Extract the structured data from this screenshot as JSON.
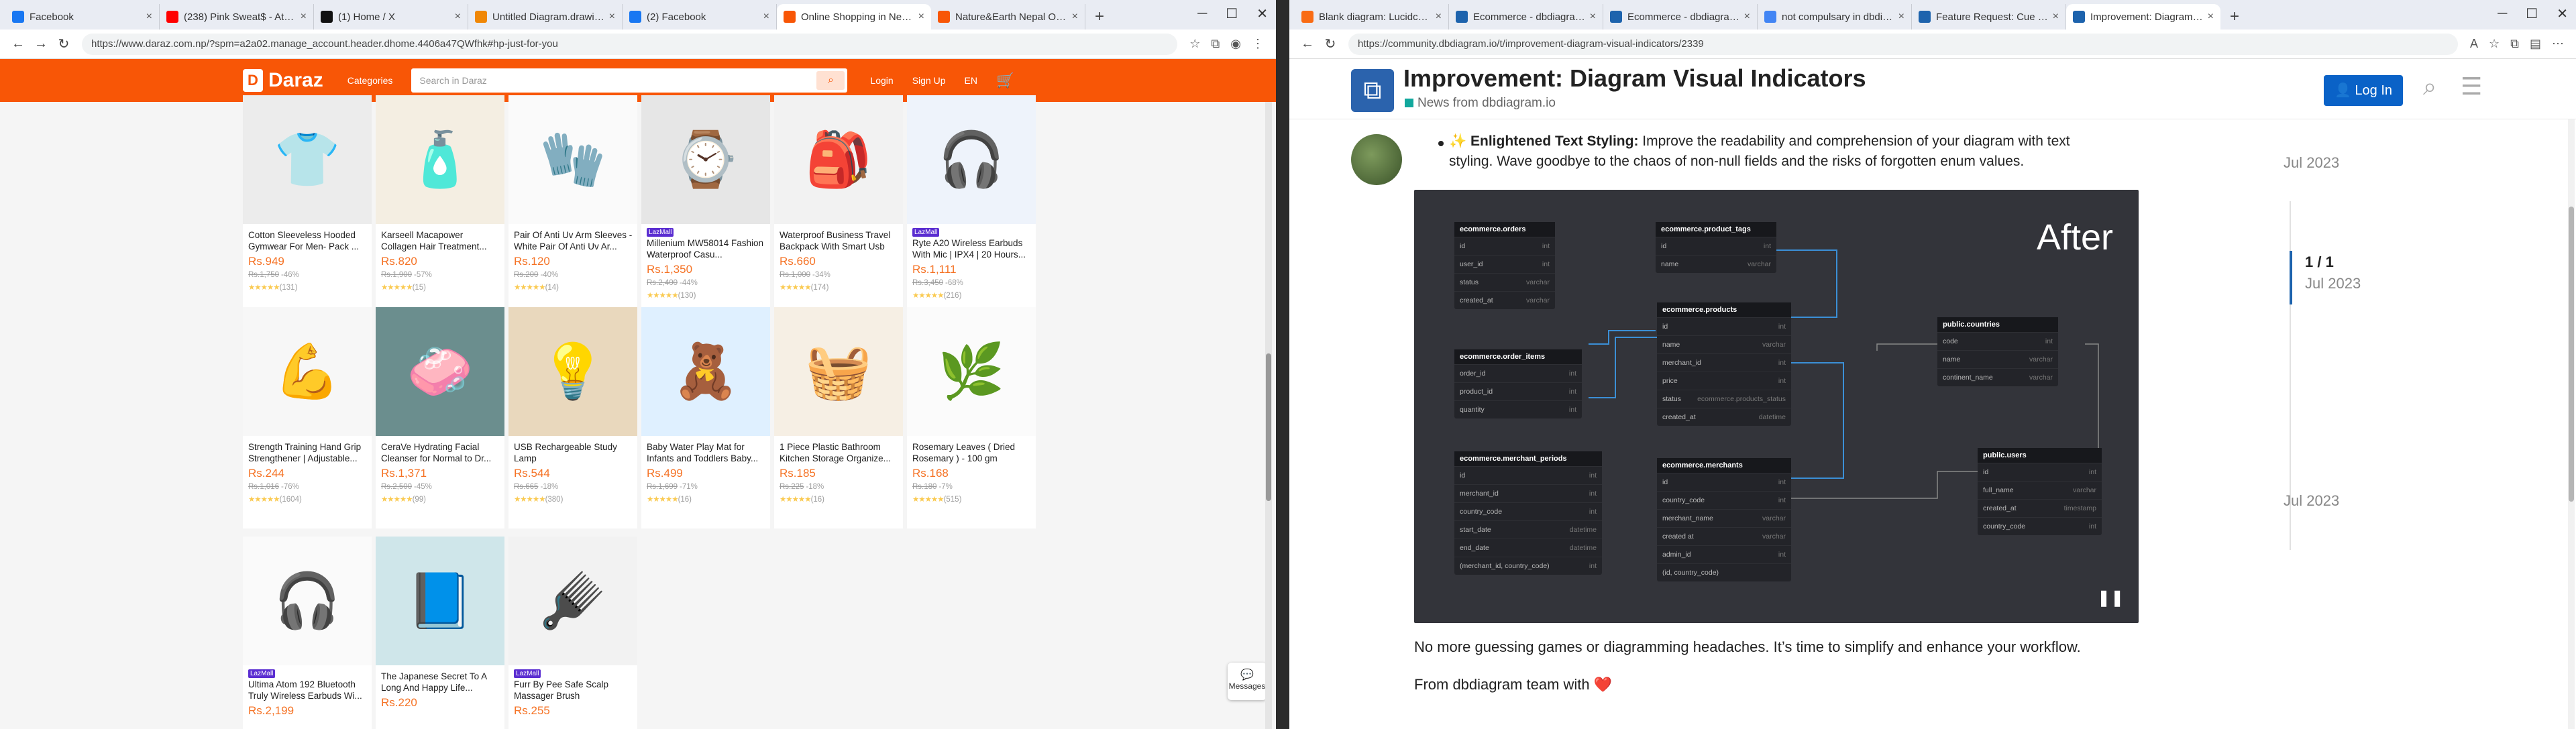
{
  "left": {
    "tabs": [
      {
        "label": "Facebook",
        "icon": "facebook-icon",
        "color": "#1877f2"
      },
      {
        "label": "(238) Pink Sweat$ - At My W...",
        "icon": "youtube-icon",
        "color": "#ff0000"
      },
      {
        "label": "(1) Home / X",
        "icon": "x-icon",
        "color": "#111111"
      },
      {
        "label": "Untitled Diagram.drawio - draw...",
        "icon": "drawio-icon",
        "color": "#f08705"
      },
      {
        "label": "(2) Facebook",
        "icon": "facebook-icon",
        "color": "#1877f2"
      },
      {
        "label": "Online Shopping in Nepal | Best...",
        "icon": "daraz-icon",
        "color": "#f85606"
      },
      {
        "label": "Nature&Earth Nepal Official Onl...",
        "icon": "daraz-icon",
        "color": "#f85606"
      }
    ],
    "url": "https://www.daraz.com.np/?spm=a2a02.manage_account.header.dhome.4406a47QWfhk#hp-just-for-you",
    "header": {
      "logo": "Daraz",
      "categories": "Categories",
      "search_placeholder": "Search in Daraz",
      "login": "Login",
      "signup": "Sign Up",
      "lang": "EN"
    },
    "products": [
      {
        "name": "Cotton Sleeveless Hooded Gymwear For Men- Pack ...",
        "price": "Rs.949",
        "old": "Rs.1,750",
        "disc": "-46%",
        "stars": "★★★★★",
        "reviews": "(131)",
        "emoji": "👕",
        "bg": "#ececec",
        "lzd": ""
      },
      {
        "name": "Karseell Macapower Collagen Hair Treatment...",
        "price": "Rs.820",
        "old": "Rs.1,900",
        "disc": "-57%",
        "stars": "★★★★★",
        "reviews": "(15)",
        "emoji": "🧴",
        "bg": "#f4eee2",
        "lzd": ""
      },
      {
        "name": "Pair Of Anti Uv Arm Sleeves - White Pair Of Anti Uv Ar...",
        "price": "Rs.120",
        "old": "Rs.200",
        "disc": "-40%",
        "stars": "★★★★★",
        "reviews": "(14)",
        "emoji": "🧤",
        "bg": "#fafafa",
        "lzd": ""
      },
      {
        "name": "Millenium MW58014 Fashion Waterproof Casu...",
        "price": "Rs.1,350",
        "old": "Rs.2,400",
        "disc": "-44%",
        "stars": "★★★★★",
        "reviews": "(130)",
        "emoji": "⌚",
        "bg": "#e6e6e6",
        "lzd": "LazMall"
      },
      {
        "name": "Waterproof Business Travel Backpack With Smart Usb",
        "price": "Rs.660",
        "old": "Rs.1,000",
        "disc": "-34%",
        "stars": "★★★★★",
        "reviews": "(174)",
        "emoji": "🎒",
        "bg": "#f2f2f2",
        "lzd": ""
      },
      {
        "name": "Ryte A20 Wireless Earbuds With Mic | IPX4 | 20 Hours...",
        "price": "Rs.1,111",
        "old": "Rs.3,450",
        "disc": "-68%",
        "stars": "★★★★★",
        "reviews": "(216)",
        "emoji": "🎧",
        "bg": "#eef3fb",
        "lzd": "LazMall"
      },
      {
        "name": "Strength Training Hand Grip Strengthener | Adjustable...",
        "price": "Rs.244",
        "old": "Rs.1,016",
        "disc": "-76%",
        "stars": "★★★★★",
        "reviews": "(1604)",
        "emoji": "💪",
        "bg": "#f7f7f7",
        "lzd": ""
      },
      {
        "name": "CeraVe Hydrating Facial Cleanser for Normal to Dr...",
        "price": "Rs.1,371",
        "old": "Rs.2,500",
        "disc": "-45%",
        "stars": "★★★★★",
        "reviews": "(99)",
        "emoji": "🧼",
        "bg": "#6b8e8e",
        "lzd": ""
      },
      {
        "name": "USB Rechargeable Study Lamp",
        "price": "Rs.544",
        "old": "Rs.665",
        "disc": "-18%",
        "stars": "★★★★★",
        "reviews": "(380)",
        "emoji": "💡",
        "bg": "#e9d8bd",
        "lzd": ""
      },
      {
        "name": "Baby Water Play Mat for Infants and Toddlers Baby...",
        "price": "Rs.499",
        "old": "Rs.1,699",
        "disc": "-71%",
        "stars": "★★★★★",
        "reviews": "(16)",
        "emoji": "🧸",
        "bg": "#dff0ff",
        "lzd": ""
      },
      {
        "name": "1 Piece Plastic Bathroom Kitchen Storage Organize...",
        "price": "Rs.185",
        "old": "Rs.225",
        "disc": "-18%",
        "stars": "★★★★★",
        "reviews": "(16)",
        "emoji": "🧺",
        "bg": "#f6efe4",
        "lzd": ""
      },
      {
        "name": "Rosemary Leaves ( Dried Rosemary ) - 100 gm",
        "price": "Rs.168",
        "old": "Rs.180",
        "disc": "-7%",
        "stars": "★★★★★",
        "reviews": "(515)",
        "emoji": "🌿",
        "bg": "#fbfbfb",
        "lzd": ""
      },
      {
        "name": "Ultima Atom 192 Bluetooth Truly Wireless Earbuds Wi...",
        "price": "Rs.2,199",
        "old": "",
        "disc": "",
        "stars": "",
        "reviews": "",
        "emoji": "🎧",
        "bg": "#fafafa",
        "lzd": "LazMall"
      },
      {
        "name": "The Japanese Secret To A Long And Happy Life...",
        "price": "Rs.220",
        "old": "",
        "disc": "",
        "stars": "",
        "reviews": "",
        "emoji": "📘",
        "bg": "#cfe6ea",
        "lzd": ""
      },
      {
        "name": "Furr By Pee Safe Scalp Massager Brush",
        "price": "Rs.255",
        "old": "",
        "disc": "",
        "stars": "",
        "reviews": "",
        "emoji": "🪮",
        "bg": "#f2f2f2",
        "lzd": "LazMall"
      }
    ],
    "messages": "Messages",
    "product_position_note": "grid"
  },
  "right": {
    "tabs": [
      {
        "label": "Blank diagram: Lucidchart",
        "icon": "lucid-icon",
        "color": "#f96b13"
      },
      {
        "label": "Ecommerce - dbdiagram.io",
        "icon": "dbdiagram-icon",
        "color": "#1d63ad"
      },
      {
        "label": "Ecommerce - dbdiagram.io",
        "icon": "dbdiagram-icon",
        "color": "#1d63ad"
      },
      {
        "label": "not compulsary in dbdiagram",
        "icon": "google-icon",
        "color": "#4285f4"
      },
      {
        "label": "Feature Request: Cue to ...",
        "icon": "dbdiagram-icon",
        "color": "#1d63ad"
      },
      {
        "label": "Improvement: Diagram Visu...",
        "icon": "dbdiagram-icon",
        "color": "#1d63ad"
      }
    ],
    "url": "https://community.dbdiagram.io/t/improvement-diagram-visual-indicators/2339",
    "title": "Improvement: Diagram Visual Indicators",
    "category": "News from dbdiagram.io",
    "login": "Log In",
    "post": {
      "heading": "Enlightened Text Styling:",
      "body": "Improve the readability and comprehension of your diagram with text styling. Wave goodbye to the chaos of non-null fields and the risks of forgotten enum values.",
      "image_label": "After",
      "footer1": "No more guessing games or diagramming headaches. It’s time to simplify and enhance your workflow.",
      "footer2": "From dbdiagram team with"
    },
    "dates": [
      "Jul 2023",
      "Jul 2023",
      "Jul 2023"
    ],
    "timeline": {
      "count": "1 / 1"
    },
    "diagram": [
      {
        "title": "ecommerce.orders",
        "rows": [
          [
            "id",
            "int"
          ],
          [
            "user_id",
            "int"
          ],
          [
            "status",
            "varchar"
          ],
          [
            "created_at",
            "varchar"
          ]
        ]
      },
      {
        "title": "ecommerce.product_tags",
        "rows": [
          [
            "id",
            "int"
          ],
          [
            "name",
            "varchar"
          ]
        ]
      },
      {
        "title": "ecommerce.products",
        "rows": [
          [
            "id",
            "int"
          ],
          [
            "name",
            "varchar"
          ],
          [
            "merchant_id",
            "int"
          ],
          [
            "price",
            "int"
          ],
          [
            "status",
            "ecommerce.products_status"
          ],
          [
            "created_at",
            "datetime"
          ]
        ]
      },
      {
        "title": "public.countries",
        "rows": [
          [
            "code",
            "int"
          ],
          [
            "name",
            "varchar"
          ],
          [
            "continent_name",
            "varchar"
          ]
        ]
      },
      {
        "title": "ecommerce.order_items",
        "rows": [
          [
            "order_id",
            "int"
          ],
          [
            "product_id",
            "int"
          ],
          [
            "quantity",
            "int"
          ]
        ]
      },
      {
        "title": "ecommerce.merchant_periods",
        "rows": [
          [
            "id",
            "int"
          ],
          [
            "merchant_id",
            "int"
          ],
          [
            "country_code",
            "int"
          ],
          [
            "start_date",
            "datetime"
          ],
          [
            "end_date",
            "datetime"
          ],
          [
            "(merchant_id, country_code)",
            "int"
          ]
        ]
      },
      {
        "title": "ecommerce.merchants",
        "rows": [
          [
            "id",
            "int"
          ],
          [
            "country_code",
            "int"
          ],
          [
            "merchant_name",
            "varchar"
          ],
          [
            "created at",
            "varchar"
          ],
          [
            "admin_id",
            "int"
          ],
          [
            "(id, country_code)",
            ""
          ]
        ]
      },
      {
        "title": "public.users",
        "rows": [
          [
            "id",
            "int"
          ],
          [
            "full_name",
            "varchar"
          ],
          [
            "created_at",
            "timestamp"
          ],
          [
            "country_code",
            "int"
          ]
        ]
      }
    ]
  }
}
